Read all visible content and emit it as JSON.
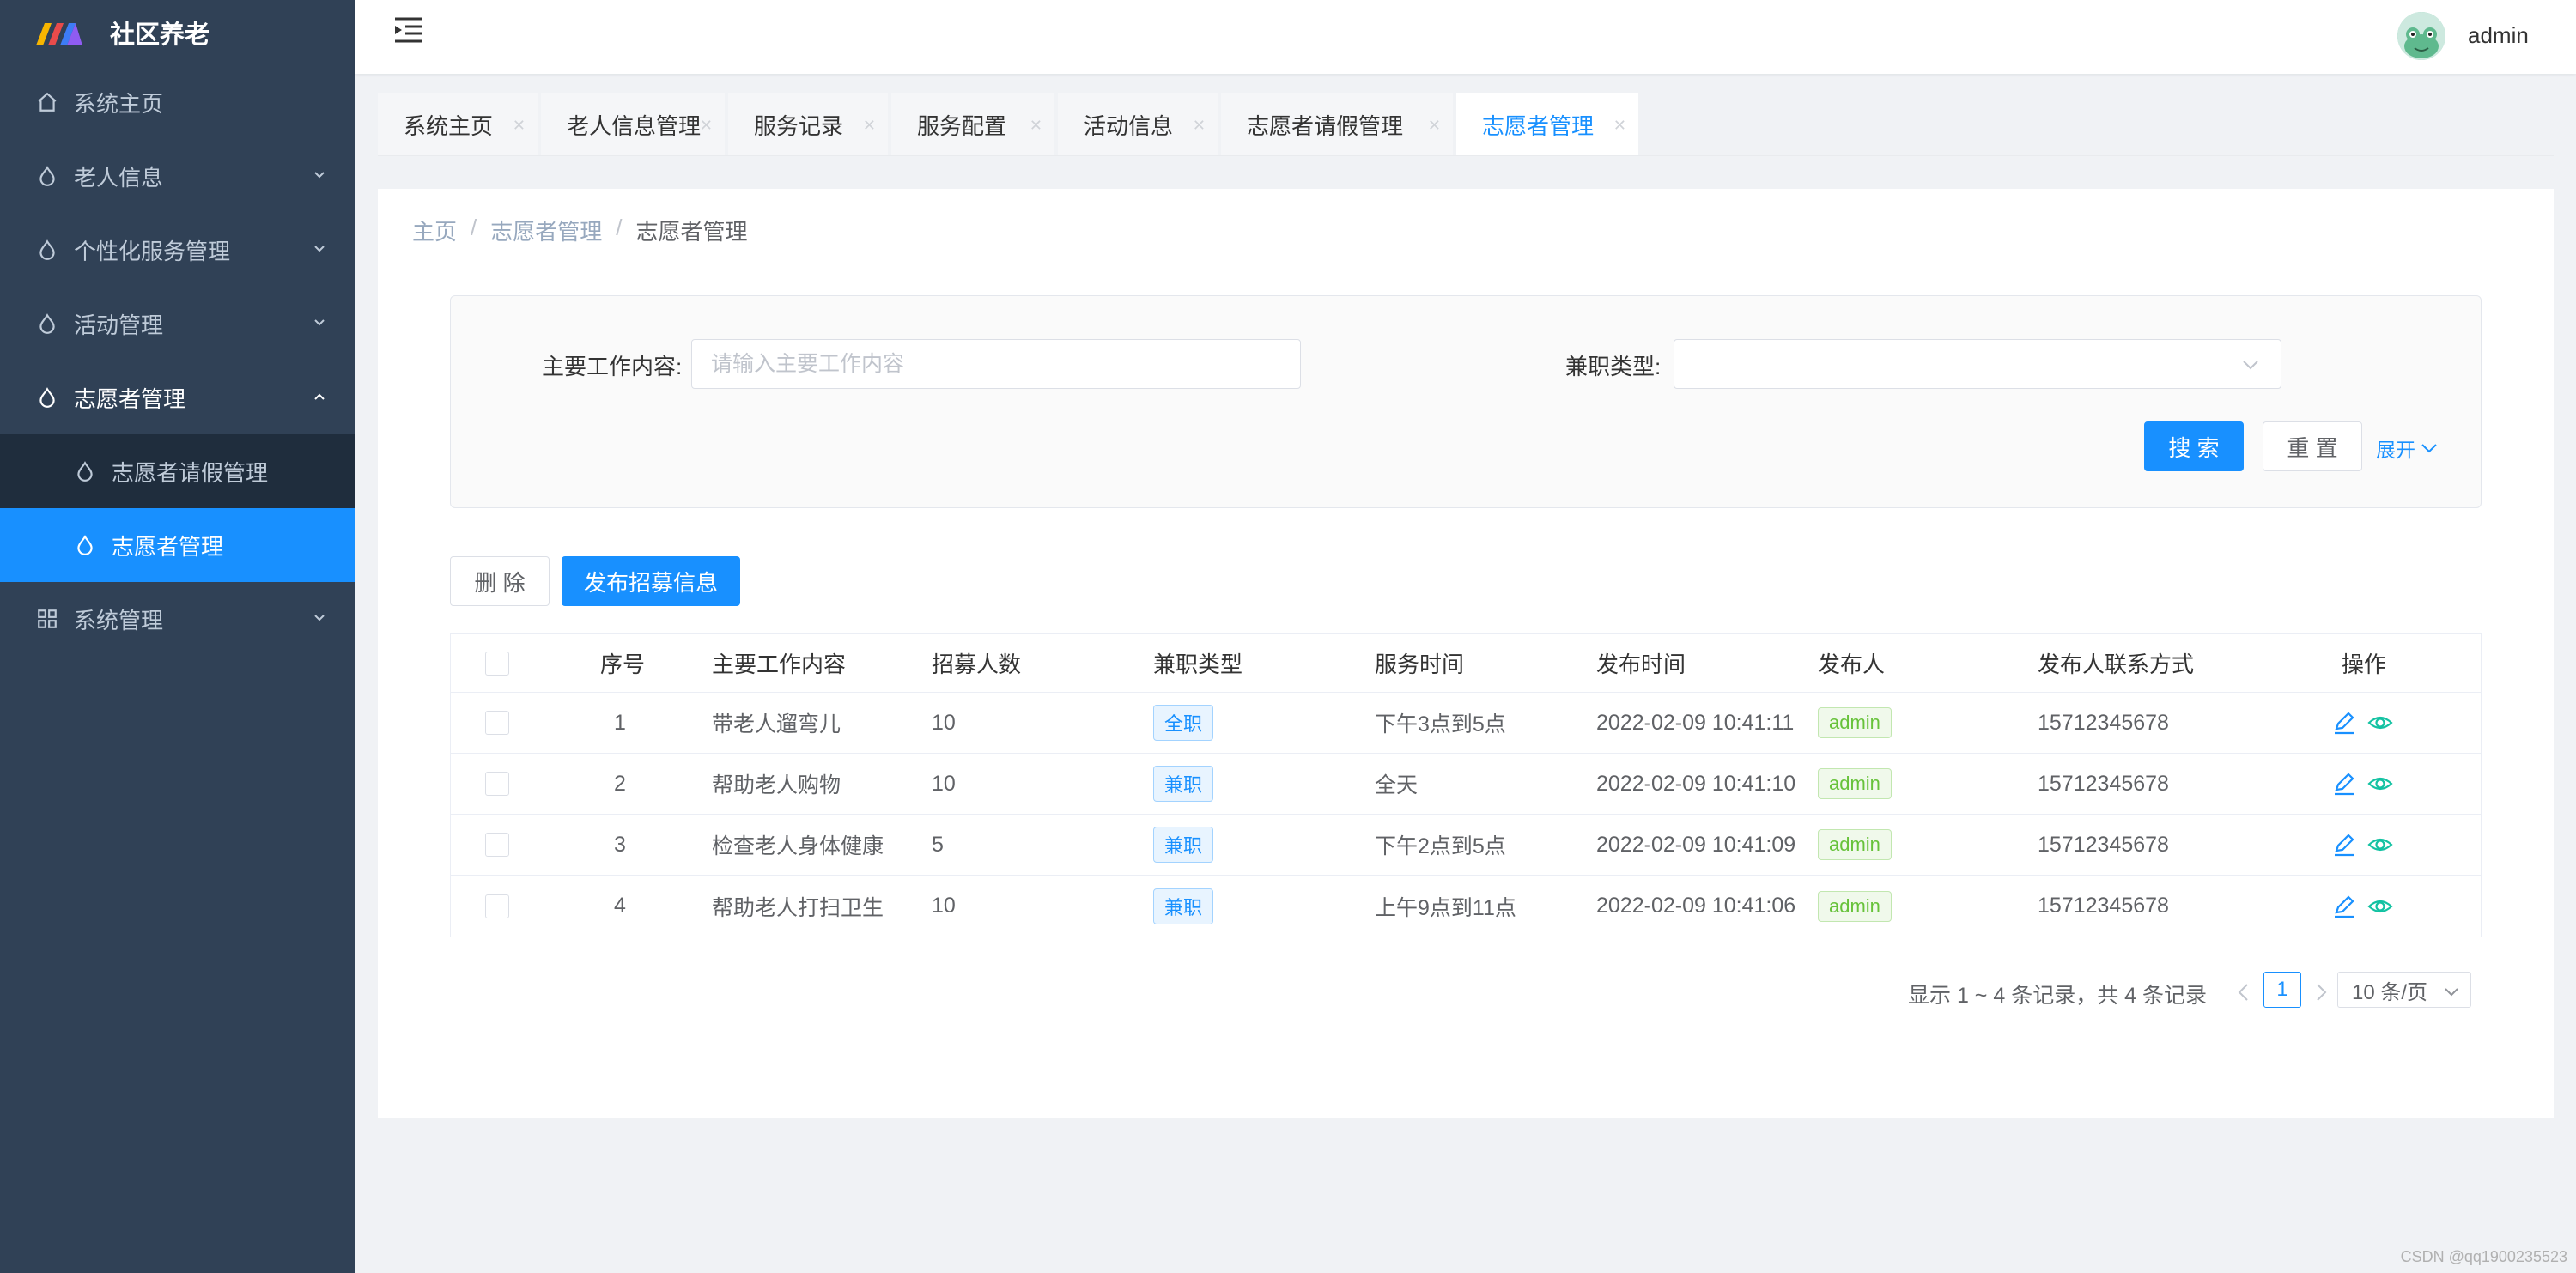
{
  "app": {
    "title": "社区养老"
  },
  "sidebar": {
    "items": [
      {
        "label": "系统主页",
        "icon": "home-icon"
      },
      {
        "label": "老人信息",
        "icon": "drop-icon"
      },
      {
        "label": "个性化服务管理",
        "icon": "drop-icon"
      },
      {
        "label": "活动管理",
        "icon": "drop-icon"
      },
      {
        "label": "志愿者管理",
        "icon": "drop-icon",
        "open": true
      },
      {
        "label": "系统管理",
        "icon": "grid-icon"
      }
    ],
    "sub_items": [
      {
        "label": "志愿者请假管理"
      },
      {
        "label": "志愿者管理",
        "active": true
      }
    ]
  },
  "header": {
    "user": "admin"
  },
  "tags": [
    {
      "label": "系统主页"
    },
    {
      "label": "老人信息管理"
    },
    {
      "label": "服务记录"
    },
    {
      "label": "服务配置"
    },
    {
      "label": "活动信息"
    },
    {
      "label": "志愿者请假管理"
    },
    {
      "label": "志愿者管理",
      "active": true
    }
  ],
  "breadcrumb": [
    "主页",
    "志愿者管理",
    "志愿者管理"
  ],
  "search": {
    "content_label": "主要工作内容:",
    "content_placeholder": "请输入主要工作内容",
    "type_label": "兼职类型:",
    "search_btn": "搜 索",
    "reset_btn": "重 置",
    "expand": "展开"
  },
  "toolbar": {
    "delete_btn": "删 除",
    "publish_btn": "发布招募信息"
  },
  "table": {
    "headers": [
      "序号",
      "主要工作内容",
      "招募人数",
      "兼职类型",
      "服务时间",
      "发布时间",
      "发布人",
      "发布人联系方式",
      "操作"
    ],
    "rows": [
      {
        "no": "1",
        "content": "带老人遛弯儿",
        "count": "10",
        "type": "全职",
        "time": "下午3点到5点",
        "published": "2022-02-09 10:41:11",
        "publisher": "admin",
        "phone": "15712345678"
      },
      {
        "no": "2",
        "content": "帮助老人购物",
        "count": "10",
        "type": "兼职",
        "time": "全天",
        "published": "2022-02-09 10:41:10",
        "publisher": "admin",
        "phone": "15712345678"
      },
      {
        "no": "3",
        "content": "检查老人身体健康",
        "count": "5",
        "type": "兼职",
        "time": "下午2点到5点",
        "published": "2022-02-09 10:41:09",
        "publisher": "admin",
        "phone": "15712345678"
      },
      {
        "no": "4",
        "content": "帮助老人打扫卫生",
        "count": "10",
        "type": "兼职",
        "time": "上午9点到11点",
        "published": "2022-02-09 10:41:06",
        "publisher": "admin",
        "phone": "15712345678"
      }
    ]
  },
  "pagination": {
    "summary": "显示 1 ~ 4 条记录，共 4 条记录",
    "current": "1",
    "page_size": "10 条/页"
  },
  "watermark": "CSDN @qq1900235523",
  "colors": {
    "primary": "#1890ff",
    "sidebar": "#304156",
    "success": "#67c23a"
  }
}
